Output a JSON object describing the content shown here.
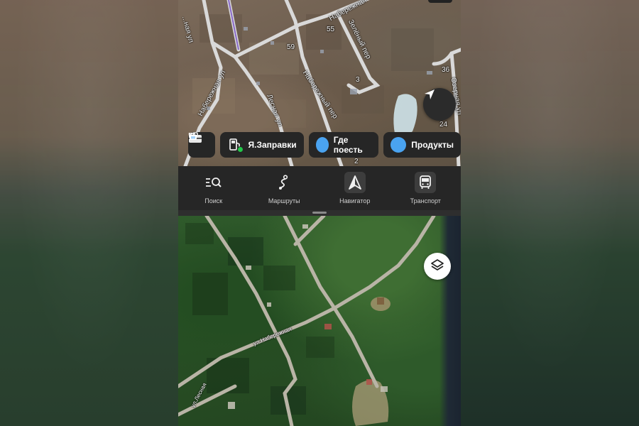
{
  "map_top": {
    "labels": {
      "street_naberezhnaya_top": "Набережная",
      "street_left_ul": "...ная ул",
      "street_naberezhnaya_ul": "Набережная ул",
      "street_lesnaya": "Лесная ул",
      "street_naberezhny_per": "Набережный пер",
      "street_zelyony_per": "Зелёный пер",
      "street_ozernaya": "Озерная ул",
      "house_55": "55",
      "house_59": "59",
      "house_3": "3",
      "house_36": "36",
      "house_24": "24",
      "house_2": "2"
    }
  },
  "quick_chips": [
    {
      "id": "briefcase",
      "label": "",
      "icon": "briefcase-icon"
    },
    {
      "id": "fuel",
      "label": "Я.Заправки",
      "icon": "fuel-pump-icon"
    },
    {
      "id": "food",
      "label": "Где поесть",
      "icon": "fork-knife-icon"
    },
    {
      "id": "groceries",
      "label": "Продукты",
      "icon": "basket-icon"
    }
  ],
  "nav": [
    {
      "id": "search",
      "label": "Поиск",
      "icon": "search-list-icon"
    },
    {
      "id": "routes",
      "label": "Маршруты",
      "icon": "route-icon"
    },
    {
      "id": "navigator",
      "label": "Навигатор",
      "icon": "navigator-arrow-icon"
    },
    {
      "id": "transport",
      "label": "Транспорт",
      "icon": "bus-icon"
    }
  ],
  "map_bottom": {
    "labels": {
      "street_naberezhnaya": "ул.Набережная",
      "street_lesnaya": "ул.Лесная"
    }
  },
  "colors": {
    "bar_bg": "#262626",
    "chip_accent": "#4aa3f0",
    "status_green": "#22c84a"
  }
}
